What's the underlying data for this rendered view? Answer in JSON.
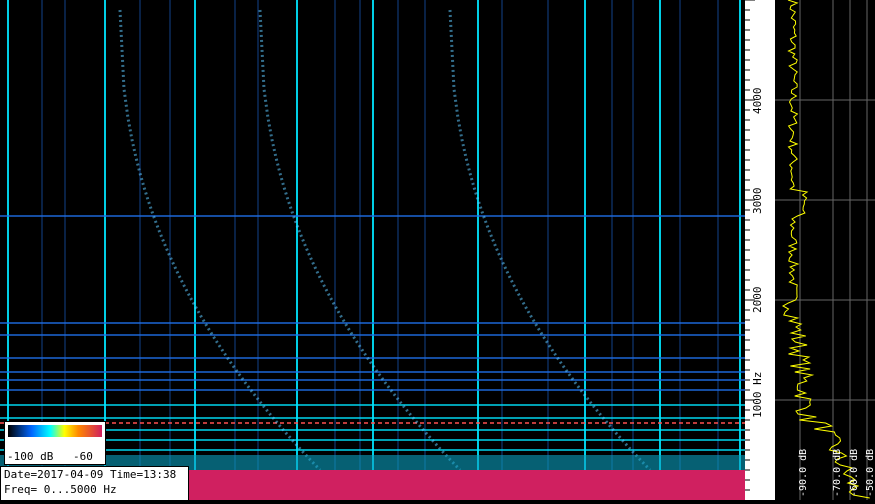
{
  "axis": {
    "ticks": [
      "1000 Hz",
      "2000",
      "3000",
      "4000"
    ]
  },
  "spectrum": {
    "db_labels": [
      "-90.0 dB",
      "-70.0 dB",
      "-60.0 dB",
      "-50.0 dB"
    ]
  },
  "legend": {
    "min_label": "-100 dB",
    "max_label": "-60"
  },
  "info": {
    "date_time": "Date=2017-04-09 Time=13:38",
    "freq": "Freq= 0...5000 Hz"
  },
  "colors": {
    "background": "#000000",
    "trace": "#ffff00",
    "noise_band": "#d02060",
    "line_blue": "#1e6ee6",
    "line_cyan": "#00e6ff"
  }
}
